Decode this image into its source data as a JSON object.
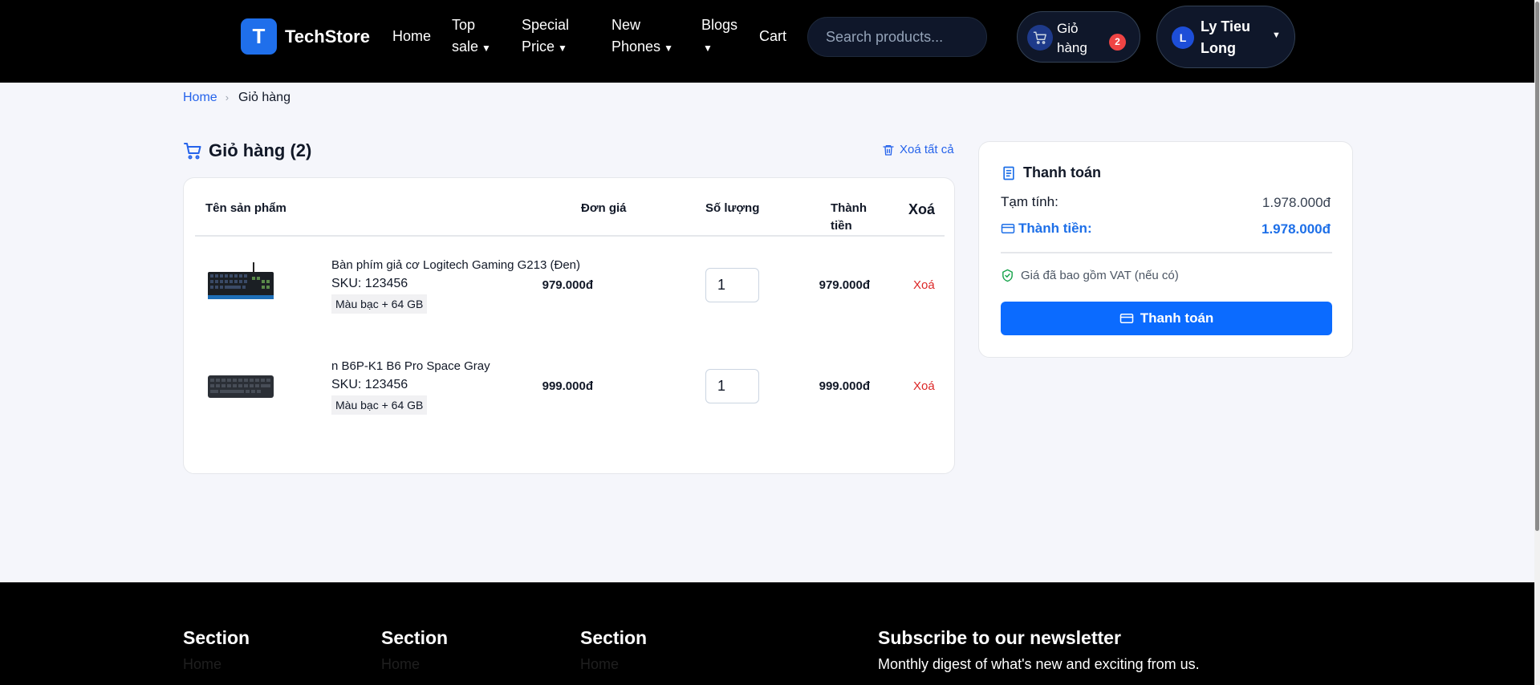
{
  "nav": {
    "logo_letter": "T",
    "logo_text": "TechStore",
    "links": {
      "home": "Home",
      "top_sale_1": "Top",
      "top_sale_2": "sale",
      "special_1": "Special",
      "special_2": "Price",
      "new_1": "New",
      "new_2": "Phones",
      "blogs": "Blogs",
      "cart": "Cart"
    },
    "caret": "▼",
    "search_placeholder": "Search products...",
    "cart_label_1": "Giỏ",
    "cart_label_2": "hàng",
    "cart_count": "2",
    "user_initial": "L",
    "user_name_1": "Ly Tieu",
    "user_name_2": "Long",
    "user_caret": "▼"
  },
  "breadcrumb": {
    "home": "Home",
    "sep": "›",
    "current": "Giỏ hàng"
  },
  "cart": {
    "title": "Giỏ hàng (2)",
    "clear_all": "Xoá tất cả",
    "headers": {
      "name": "Tên sản phẩm",
      "unit_price": "Đơn giá",
      "qty": "Số lượng",
      "total_1": "Thành",
      "total_2": "tiền",
      "delete": "Xoá"
    },
    "items": [
      {
        "name": "Bàn phím giả cơ Logitech Gaming G213 (Đen)",
        "sku": "SKU: 123456",
        "variant": "Màu bạc + 64 GB",
        "unit_price": "979.000đ",
        "qty": "1",
        "total": "979.000đ",
        "delete": "Xoá"
      },
      {
        "name": "n B6P-K1 B6 Pro Space Gray",
        "sku": "SKU: 123456",
        "variant": "Màu bạc + 64 GB",
        "unit_price": "999.000đ",
        "qty": "1",
        "total": "999.000đ",
        "delete": "Xoá"
      }
    ]
  },
  "summary": {
    "title": "Thanh toán",
    "subtotal_label": "Tạm tính:",
    "subtotal_value": "1.978.000đ",
    "total_label": "Thành tiền:",
    "total_value": "1.978.000đ",
    "vat_note": "Giá đã bao gồm VAT (nếu có)",
    "pay_button": "Thanh toán"
  },
  "footer": {
    "sections": [
      "Section",
      "Section",
      "Section"
    ],
    "links": [
      "Home",
      "Home",
      "Home"
    ],
    "newsletter_title": "Subscribe to our newsletter",
    "newsletter_desc": "Monthly digest of what's new and exciting from us."
  },
  "colors": {
    "accent": "#0b6bff",
    "danger": "#dc2626",
    "nav_bg": "#000000"
  }
}
